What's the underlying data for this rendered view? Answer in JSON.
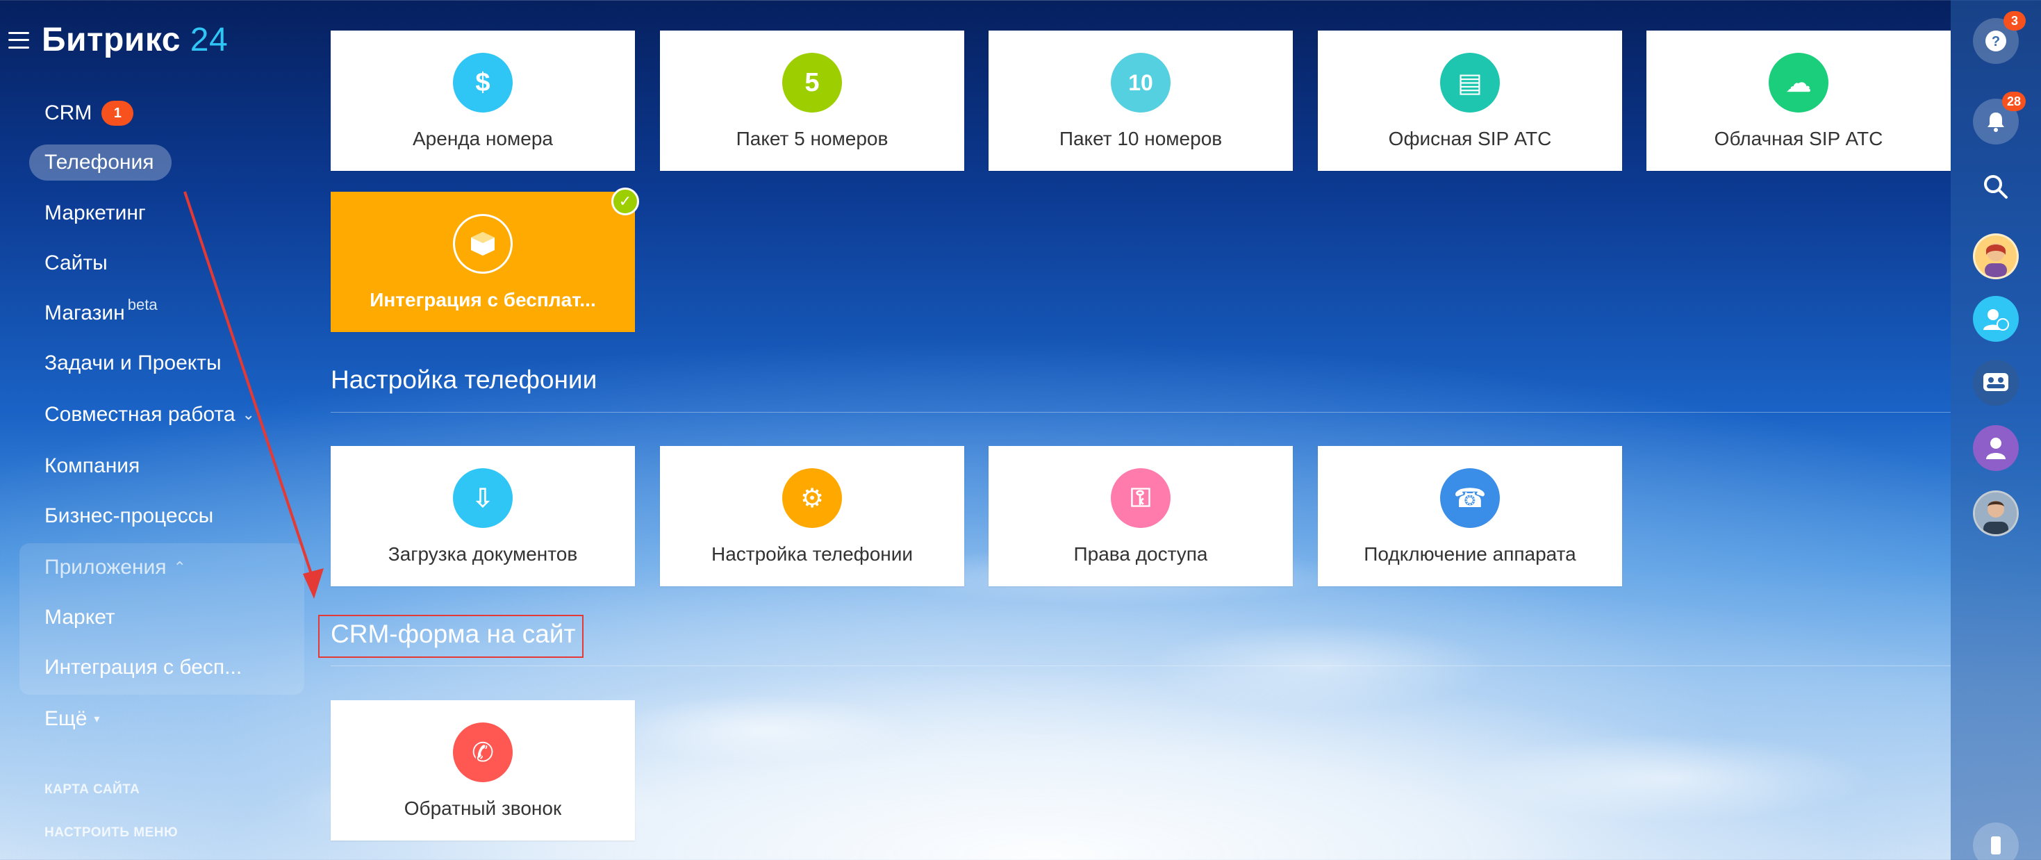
{
  "app": {
    "logo_main": "Битрикс",
    "logo_num": "24"
  },
  "sidebar": {
    "items": [
      {
        "label": "CRM",
        "badge": "1"
      },
      {
        "label": "Телефония"
      },
      {
        "label": "Маркетинг"
      },
      {
        "label": "Сайты"
      },
      {
        "label": "Магазин",
        "sup": "beta"
      },
      {
        "label": "Задачи и Проекты"
      },
      {
        "label": "Совместная работа",
        "chevron": "⌄"
      },
      {
        "label": "Компания"
      },
      {
        "label": "Бизнес-процессы"
      }
    ],
    "apps_group": {
      "title": "Приложения",
      "chevron": "⌃",
      "items": [
        {
          "label": "Маркет"
        },
        {
          "label": "Интеграция с бесп..."
        }
      ]
    },
    "more": {
      "label": "Ещё",
      "chevron": "▾"
    },
    "site_map": "КАРТА САЙТА",
    "configure_menu": "НАСТРОИТЬ МЕНЮ"
  },
  "tiles_top": [
    {
      "label": "Аренда номера",
      "icon": "phone-dollar-icon",
      "color": "#2fc6f6",
      "glyph": "$"
    },
    {
      "label": "Пакет 5 номеров",
      "icon": "keypad-5-icon",
      "color": "#9dcf00",
      "glyph": "5"
    },
    {
      "label": "Пакет 10 номеров",
      "icon": "keypad-10-icon",
      "color": "#55d0e0",
      "glyph": "10"
    },
    {
      "label": "Офисная SIP АТС",
      "icon": "office-pbx-icon",
      "color": "#1ec6b0",
      "glyph": "▤"
    },
    {
      "label": "Облачная SIP АТС",
      "icon": "cloud-pbx-icon",
      "color": "#1bce7b",
      "glyph": "☁"
    }
  ],
  "tile_selected": {
    "label": "Интеграция с бесплат...",
    "icon": "box-icon",
    "color": "#ffaa00",
    "check": "✓"
  },
  "sections": {
    "telephony_settings": {
      "title": "Настройка телефонии",
      "tiles": [
        {
          "label": "Загрузка документов",
          "icon": "document-download-icon",
          "color": "#2fc6f6",
          "glyph": "⇩"
        },
        {
          "label": "Настройка телефонии",
          "icon": "phone-settings-icon",
          "color": "#ffa900",
          "glyph": "⚙"
        },
        {
          "label": "Права доступа",
          "icon": "access-rights-icon",
          "color": "#ff7bac",
          "glyph": "⚿"
        },
        {
          "label": "Подключение аппарата",
          "icon": "phone-connect-icon",
          "color": "#3b8ee8",
          "glyph": "☎"
        }
      ]
    },
    "crm_form": {
      "title": "CRM-форма на сайт",
      "tiles": [
        {
          "label": "Обратный звонок",
          "icon": "callback-icon",
          "color": "#ff5752",
          "glyph": "✆"
        }
      ]
    }
  },
  "rightbar": {
    "help_count": "3",
    "notifications_count": "28"
  }
}
